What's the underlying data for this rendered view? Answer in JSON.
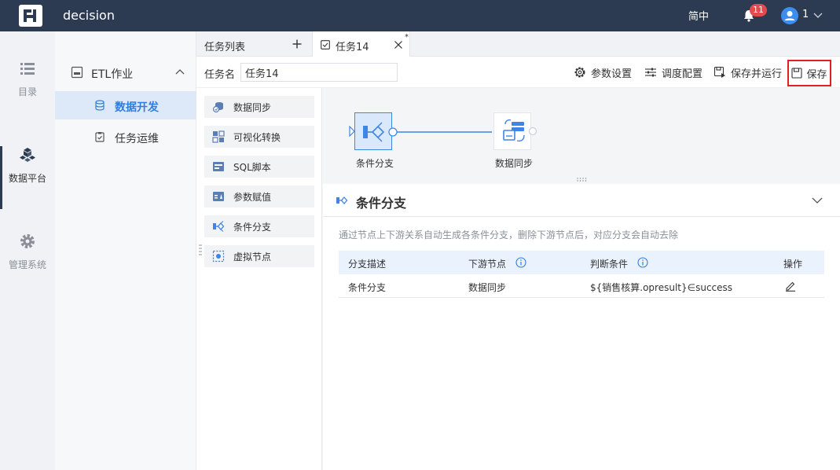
{
  "app": {
    "title": "decision"
  },
  "topbar": {
    "lang": "简中",
    "notification_count": "11",
    "user_name": "1"
  },
  "leftnav": [
    {
      "label": "目录",
      "icon": "list-icon"
    },
    {
      "label": "数据平台",
      "icon": "cube-cluster-icon"
    },
    {
      "label": "管理系统",
      "icon": "gear-icon"
    }
  ],
  "sidebar": {
    "group": "ETL作业",
    "items": [
      {
        "label": "数据开发",
        "icon": "database-icon"
      },
      {
        "label": "任务运维",
        "icon": "clipboard-icon"
      }
    ]
  },
  "tabs": {
    "list_label": "任务列表",
    "active_label": "任务14",
    "dirty_mark": "*"
  },
  "task": {
    "name_label": "任务名",
    "name_value": "任务14",
    "toolbar": {
      "params": "参数设置",
      "schedule": "调度配置",
      "save_run": "保存并运行",
      "save": "保存"
    }
  },
  "palette": [
    {
      "label": "数据同步",
      "icon": "data-sync-icon"
    },
    {
      "label": "可视化转换",
      "icon": "visual-transform-icon"
    },
    {
      "label": "SQL脚本",
      "icon": "sql-script-icon"
    },
    {
      "label": "参数赋值",
      "icon": "param-assign-icon"
    },
    {
      "label": "条件分支",
      "icon": "branch-icon"
    },
    {
      "label": "虚拟节点",
      "icon": "virtual-node-icon"
    }
  ],
  "canvas": {
    "node_a": "条件分支",
    "node_b": "数据同步"
  },
  "detail": {
    "title": "条件分支",
    "description": "通过节点上下游关系自动生成各条件分支，删除下游节点后，对应分支会自动去除",
    "columns": [
      "分支描述",
      "下游节点",
      "判断条件",
      "操作"
    ],
    "rows": [
      {
        "desc": "条件分支",
        "downstream": "数据同步",
        "condition": "${销售核算.opresult}∈success"
      }
    ]
  },
  "colors": {
    "topbar": "#2c3a52",
    "accent": "#2f7de1",
    "save_highlight": "#e02020"
  }
}
